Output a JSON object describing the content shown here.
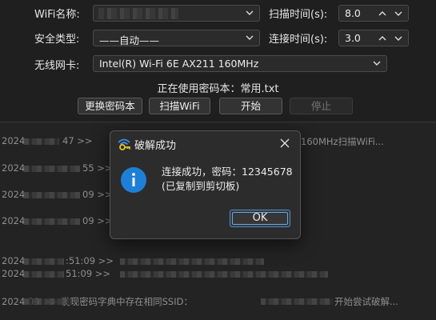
{
  "form": {
    "wifi_label": "WiFi名称:",
    "security_label": "安全类型:",
    "adapter_label": "无线网卡:",
    "security_value": "——自动——",
    "adapter_value": "Intel(R) Wi-Fi 6E AX211 160MHz",
    "scan_time_label": "扫描时间(s):",
    "scan_time_value": "8.0",
    "connect_time_label": "连接时间(s):",
    "connect_time_value": "3.0"
  },
  "status": "正在使用密码本：常用.txt",
  "buttons": {
    "change_dict": "更换密码本",
    "scan_wifi": "扫描WiFi",
    "start": "开始",
    "stop": "停止"
  },
  "log": {
    "l1_time": "2024",
    "l1_tail": "47 >>",
    "l1_right": "160MHz扫描WiFi...",
    "l2_time": "2024",
    "l2_mid": "55 >>",
    "l3_time": "2024",
    "l3_mid": "09 >>",
    "l4_time": "2024",
    "l4_mid": "09 >>",
    "l5_time": "2024",
    "l5_mid": ":51:09 >>",
    "l6_time": "2024",
    "l6_mid": "51:09 >>",
    "l7_text": "2024          09 >> 发现密码字典中存在相同SSID：",
    "l7_tail": "开始尝试破解..."
  },
  "dialog": {
    "title": "破解成功",
    "message_line1": "连接成功，密码：12345678",
    "message_line2": "(已复制到剪切板)",
    "ok_label": "OK"
  }
}
